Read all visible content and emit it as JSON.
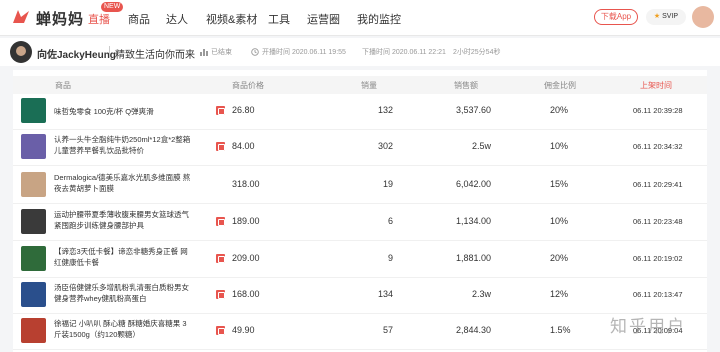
{
  "brand": {
    "name": "蝉妈妈",
    "icon": "cicada-logo-icon",
    "color": "#e8554e"
  },
  "nav": {
    "items": [
      {
        "label": "直播",
        "badge": "NEW",
        "active": true
      },
      {
        "label": "商品"
      },
      {
        "label": "达人"
      },
      {
        "label": "视频&素材"
      },
      {
        "label": "工具"
      },
      {
        "label": "运营圈"
      },
      {
        "label": "我的监控"
      }
    ],
    "download_label": "下载App",
    "svip_label": "SVIP"
  },
  "live": {
    "host": "向佐JackyHeung",
    "title": "精致生活向你而来",
    "status": "已结束",
    "start": "开播时间 2020.06.11 19:55",
    "end": "下播时间 2020.06.11 22:21",
    "duration": "2小时25分54秒"
  },
  "table": {
    "headers": [
      "商品",
      "商品价格",
      "销量",
      "销售额",
      "佣金比例",
      "上架时间"
    ],
    "sort_column": "上架时间",
    "rows": [
      {
        "name_lines": [
          "味哲兔零食 100克/杯 Q弹爽滑"
        ],
        "icon": "tmall-icon",
        "price": "26.80",
        "sales": "132",
        "revenue": "3,537.60",
        "commission": "20%",
        "listed": "06.11 20:39:28",
        "img_color": "#1a6e55"
      },
      {
        "name_lines": [
          "认养一头牛全脂纯牛奶250ml*12盒*2整箱",
          "儿童营养早餐乳饮品批特价"
        ],
        "icon": "tmall-icon",
        "price": "84.00",
        "sales": "302",
        "revenue": "2.5w",
        "commission": "10%",
        "listed": "06.11 20:34:32",
        "img_color": "#6a5fa8"
      },
      {
        "name_lines": [
          "Dermalogica/德美乐嘉水光肌多维面膜 熬",
          "夜去黄胡萝卜面膜"
        ],
        "icon": "",
        "price": "318.00",
        "sales": "19",
        "revenue": "6,042.00",
        "commission": "15%",
        "listed": "06.11 20:29:41",
        "img_color": "#c8a484"
      },
      {
        "name_lines": [
          "运动护腰带夏季薄收腹束腰男女篮球透气",
          "紧囤跑步训练健身腰部护具"
        ],
        "icon": "tmall-icon",
        "price": "189.00",
        "sales": "6",
        "revenue": "1,134.00",
        "commission": "10%",
        "listed": "06.11 20:23:48",
        "img_color": "#3a3a3a"
      },
      {
        "name_lines": [
          "【谛恋3天低卡餐】谛恋非糖秀身正餐 网",
          "红健康低卡餐"
        ],
        "icon": "tmall-icon",
        "price": "209.00",
        "sales": "9",
        "revenue": "1,881.00",
        "commission": "20%",
        "listed": "06.11 20:19:02",
        "img_color": "#2f6b3a"
      },
      {
        "name_lines": [
          "汤臣倍健健乐多增肌粉乳清蛋白质粉男女",
          "健身营养whey健肌粉高蛋白"
        ],
        "icon": "tmall-icon",
        "price": "168.00",
        "sales": "134",
        "revenue": "2.3w",
        "commission": "12%",
        "listed": "06.11 20:13:47",
        "img_color": "#2a4f8c"
      },
      {
        "name_lines": [
          "徐福记 小叭叭 酥心糖 酥糖婚庆喜糖果 3",
          "斤装1500g（约120颗糖）"
        ],
        "icon": "tmall-icon",
        "price": "49.90",
        "sales": "57",
        "revenue": "2,844.30",
        "commission": "1.5%",
        "listed": "06.11 20:09:04",
        "img_color": "#b84030"
      }
    ]
  },
  "watermark": "知乎用户"
}
